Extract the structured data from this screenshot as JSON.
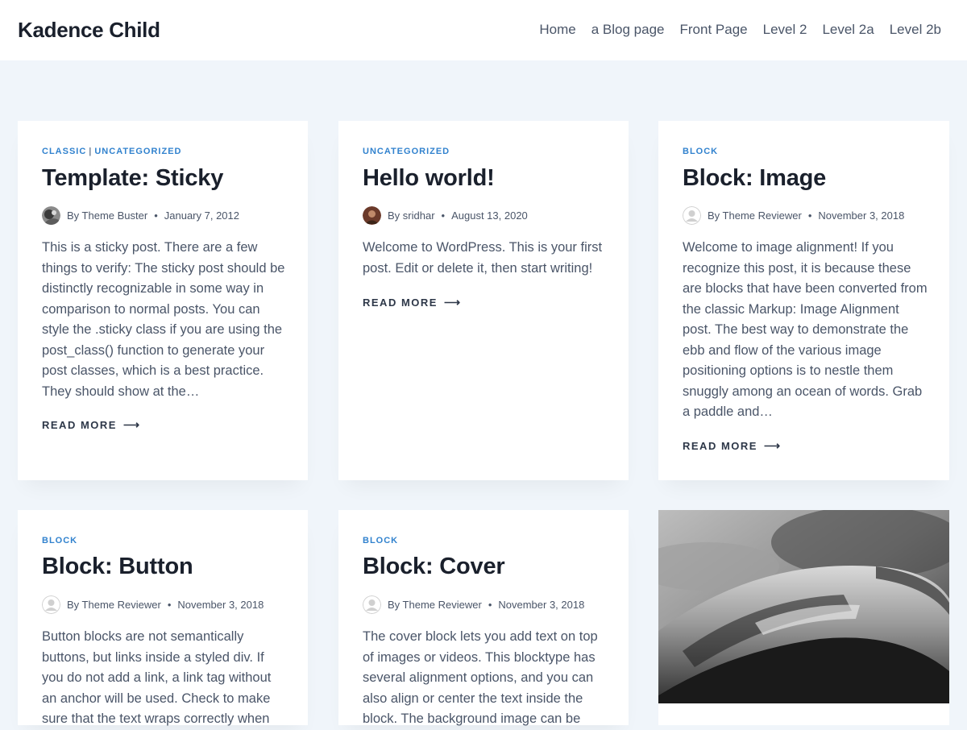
{
  "site": {
    "title": "Kadence Child",
    "nav": [
      "Home",
      "a Blog page",
      "Front Page",
      "Level 2",
      "Level 2a",
      "Level 2b"
    ]
  },
  "colors": {
    "accent": "#3182ce",
    "background": "#f0f5fa",
    "heading": "#1a202c"
  },
  "posts": [
    {
      "categories": [
        "CLASSIC",
        "UNCATEGORIZED"
      ],
      "title": "Template: Sticky",
      "author": "By Theme Buster",
      "date": "January 7, 2012",
      "excerpt": "This is a sticky post. There are a few things to verify: The sticky post should be distinctly recognizable in some way in comparison to normal posts. You can style the .sticky class if you are using the post_class() function to generate your post classes, which is a best practice. They should show at the…",
      "read_more": "READ MORE"
    },
    {
      "categories": [
        "UNCATEGORIZED"
      ],
      "title": "Hello world!",
      "author": "By sridhar",
      "date": "August 13, 2020",
      "excerpt": "Welcome to WordPress. This is your first post. Edit or delete it, then start writing!",
      "read_more": "READ MORE"
    },
    {
      "categories": [
        "BLOCK"
      ],
      "title": "Block: Image",
      "author": "By Theme Reviewer",
      "date": "November 3, 2018",
      "excerpt": "Welcome to image alignment! If you recognize this post, it is because these are blocks that have been converted from the classic Markup: Image Alignment post. The best way to demonstrate the ebb and flow of the various image positioning options is to nestle them snuggly among an ocean of words. Grab a paddle and…",
      "read_more": "READ MORE"
    },
    {
      "categories": [
        "BLOCK"
      ],
      "title": "Block: Button",
      "author": "By Theme Reviewer",
      "date": "November 3, 2018",
      "excerpt": "Button blocks are not semantically buttons, but links inside a styled div.  If you do not add a link, a link tag without an anchor will be used. Check to make sure that the text wraps correctly when"
    },
    {
      "categories": [
        "BLOCK"
      ],
      "title": "Block: Cover",
      "author": "By Theme Reviewer",
      "date": "November 3, 2018",
      "excerpt": "The cover block lets you add text on top of images or videos. This blocktype has several alignment options, and you can also align or center the text inside the block. The background image can be"
    }
  ]
}
